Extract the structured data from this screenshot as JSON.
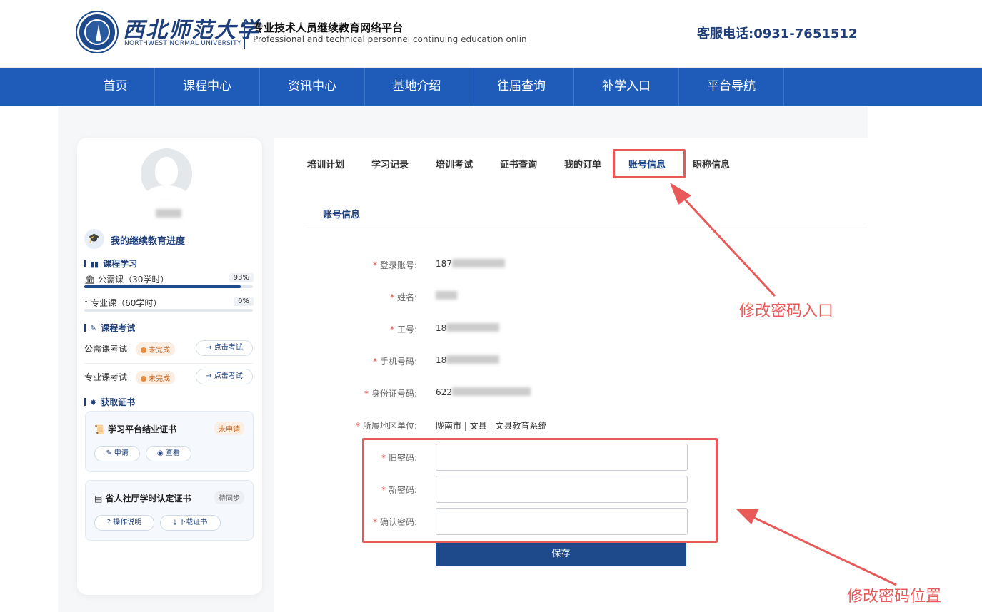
{
  "header": {
    "university_cn": "西北师范大学",
    "university_en": "NORTHWEST NORMAL UNIVERSITY",
    "platform_cn": "专业技术人员继续教育网络平台",
    "platform_en": "Professional and technical personnel continuing education onlin",
    "hotline": "客服电话:0931-7651512"
  },
  "nav": [
    "首页",
    "课程中心",
    "资讯中心",
    "基地介绍",
    "往届查询",
    "补学入口",
    "平台导航"
  ],
  "sidebar": {
    "progress_title": "我的继续教育进度",
    "course_section": "课程学习",
    "courses": [
      {
        "label": "公需课（30学时）",
        "percent": "93%",
        "progress": 0.93
      },
      {
        "label": "专业课（60学时）",
        "percent": "0%",
        "progress": 0.0
      }
    ],
    "exam_section": "课程考试",
    "exams": [
      {
        "label": "公需课考试",
        "status": "未完成",
        "action": "点击考试"
      },
      {
        "label": "专业课考试",
        "status": "未完成",
        "action": "点击考试"
      }
    ],
    "cert_section": "获取证书",
    "certs": [
      {
        "title": "学习平台结业证书",
        "status": "未申请",
        "buttons": [
          "申请",
          "查看"
        ]
      },
      {
        "title": "省人社厅学时认定证书",
        "status": "待同步",
        "buttons": [
          "操作说明",
          "下载证书"
        ]
      }
    ]
  },
  "tabs": [
    "培训计划",
    "学习记录",
    "培训考试",
    "证书查询",
    "我的订单",
    "账号信息",
    "职称信息"
  ],
  "active_tab": "账号信息",
  "account": {
    "section_title": "账号信息",
    "fields": [
      {
        "label": "登录账号:",
        "value": "187"
      },
      {
        "label": "姓名:",
        "value": ""
      },
      {
        "label": "工号:",
        "value": "18"
      },
      {
        "label": "手机号码:",
        "value": "18"
      },
      {
        "label": "身份证号码:",
        "value": "622"
      },
      {
        "label": "所属地区单位:",
        "value": "陇南市 | 文县 | 文县教育系统"
      }
    ],
    "password_fields": [
      {
        "label": "旧密码:",
        "value": ""
      },
      {
        "label": "新密码:",
        "value": ""
      },
      {
        "label": "确认密码:",
        "value": ""
      }
    ],
    "save_label": "保存"
  },
  "annotations": {
    "entry_text": "修改密码入口",
    "position_text": "修改密码位置"
  },
  "colors": {
    "nav_bg": "#1f5bb8",
    "brand": "#1e3f7a",
    "annotation": "#e85a5a",
    "save_bg": "#1e4a8c"
  }
}
